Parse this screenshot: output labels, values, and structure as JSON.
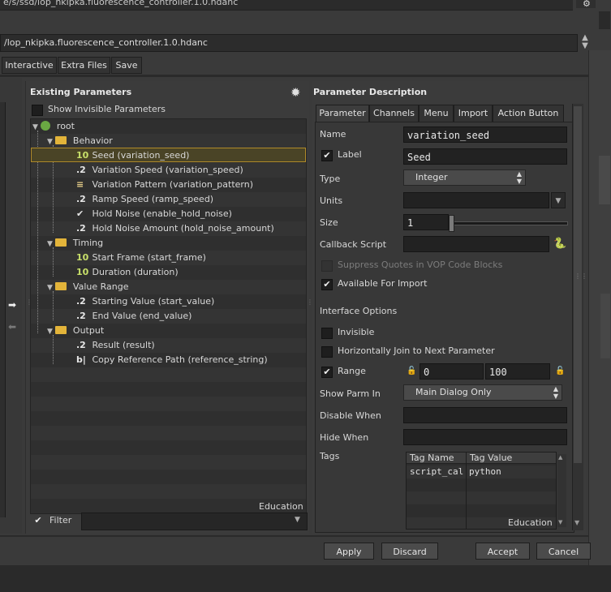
{
  "window": {
    "top_path": "e/s/ssd/lop_nkipka.fluorescence_controller.1.0.hdanc",
    "path_field": "/lop_nkipka.fluorescence_controller.1.0.hdanc"
  },
  "top_tabs": [
    "Interactive",
    "Extra Files",
    "Save"
  ],
  "existing": {
    "title": "Existing Parameters",
    "show_invisible_label": "Show Invisible Parameters",
    "watermark": "Education",
    "filter_label": "Filter",
    "tree": [
      {
        "kind": "root",
        "label": "root"
      },
      {
        "kind": "folder",
        "label": "Behavior"
      },
      {
        "kind": "int",
        "type": "10",
        "label": "Seed (variation_seed)",
        "selected": true
      },
      {
        "kind": "float",
        "type": ".2",
        "label": "Variation Speed (variation_speed)"
      },
      {
        "kind": "menu",
        "type": "≡",
        "label": "Variation Pattern (variation_pattern)"
      },
      {
        "kind": "float",
        "type": ".2",
        "label": "Ramp Speed (ramp_speed)"
      },
      {
        "kind": "toggle",
        "type": "✔",
        "label": "Hold Noise (enable_hold_noise)"
      },
      {
        "kind": "float",
        "type": ".2",
        "label": "Hold Noise Amount (hold_noise_amount)"
      },
      {
        "kind": "folder",
        "label": "Timing"
      },
      {
        "kind": "int",
        "type": "10",
        "label": "Start Frame (start_frame)"
      },
      {
        "kind": "int",
        "type": "10",
        "label": "Duration (duration)"
      },
      {
        "kind": "folder",
        "label": "Value Range"
      },
      {
        "kind": "float",
        "type": ".2",
        "label": "Starting Value (start_value)"
      },
      {
        "kind": "float",
        "type": ".2",
        "label": "End Value (end_value)"
      },
      {
        "kind": "folder",
        "label": "Output"
      },
      {
        "kind": "float",
        "type": ".2",
        "label": "Result (result)"
      },
      {
        "kind": "button",
        "type": "b|",
        "label": "Copy Reference Path (reference_string)"
      }
    ]
  },
  "description": {
    "title": "Parameter Description",
    "tabs": [
      "Parameter",
      "Channels",
      "Menu",
      "Import",
      "Action Button"
    ],
    "name_label": "Name",
    "name_value": "variation_seed",
    "label_label": "Label",
    "label_value": "Seed",
    "type_label": "Type",
    "type_value": "Integer",
    "units_label": "Units",
    "units_value": "",
    "size_label": "Size",
    "size_value": "1",
    "callback_label": "Callback Script",
    "callback_value": "",
    "suppress_label": "Suppress Quotes in VOP Code Blocks",
    "available_label": "Available For Import",
    "interface_label": "Interface Options",
    "invisible_label": "Invisible",
    "hjoin_label": "Horizontally Join to Next Parameter",
    "range_label": "Range",
    "range_min": "0",
    "range_max": "100",
    "showparm_label": "Show Parm In",
    "showparm_value": "Main Dialog Only",
    "disable_label": "Disable When",
    "disable_value": "",
    "hide_label": "Hide When",
    "hide_value": "",
    "tags_label": "Tags",
    "tags_header": [
      "Tag Name",
      "Tag Value"
    ],
    "tags_rows": [
      [
        "script_cal",
        "python"
      ]
    ],
    "tags_watermark": "Education"
  },
  "buttons": {
    "apply": "Apply",
    "discard": "Discard",
    "accept": "Accept",
    "cancel": "Cancel"
  }
}
